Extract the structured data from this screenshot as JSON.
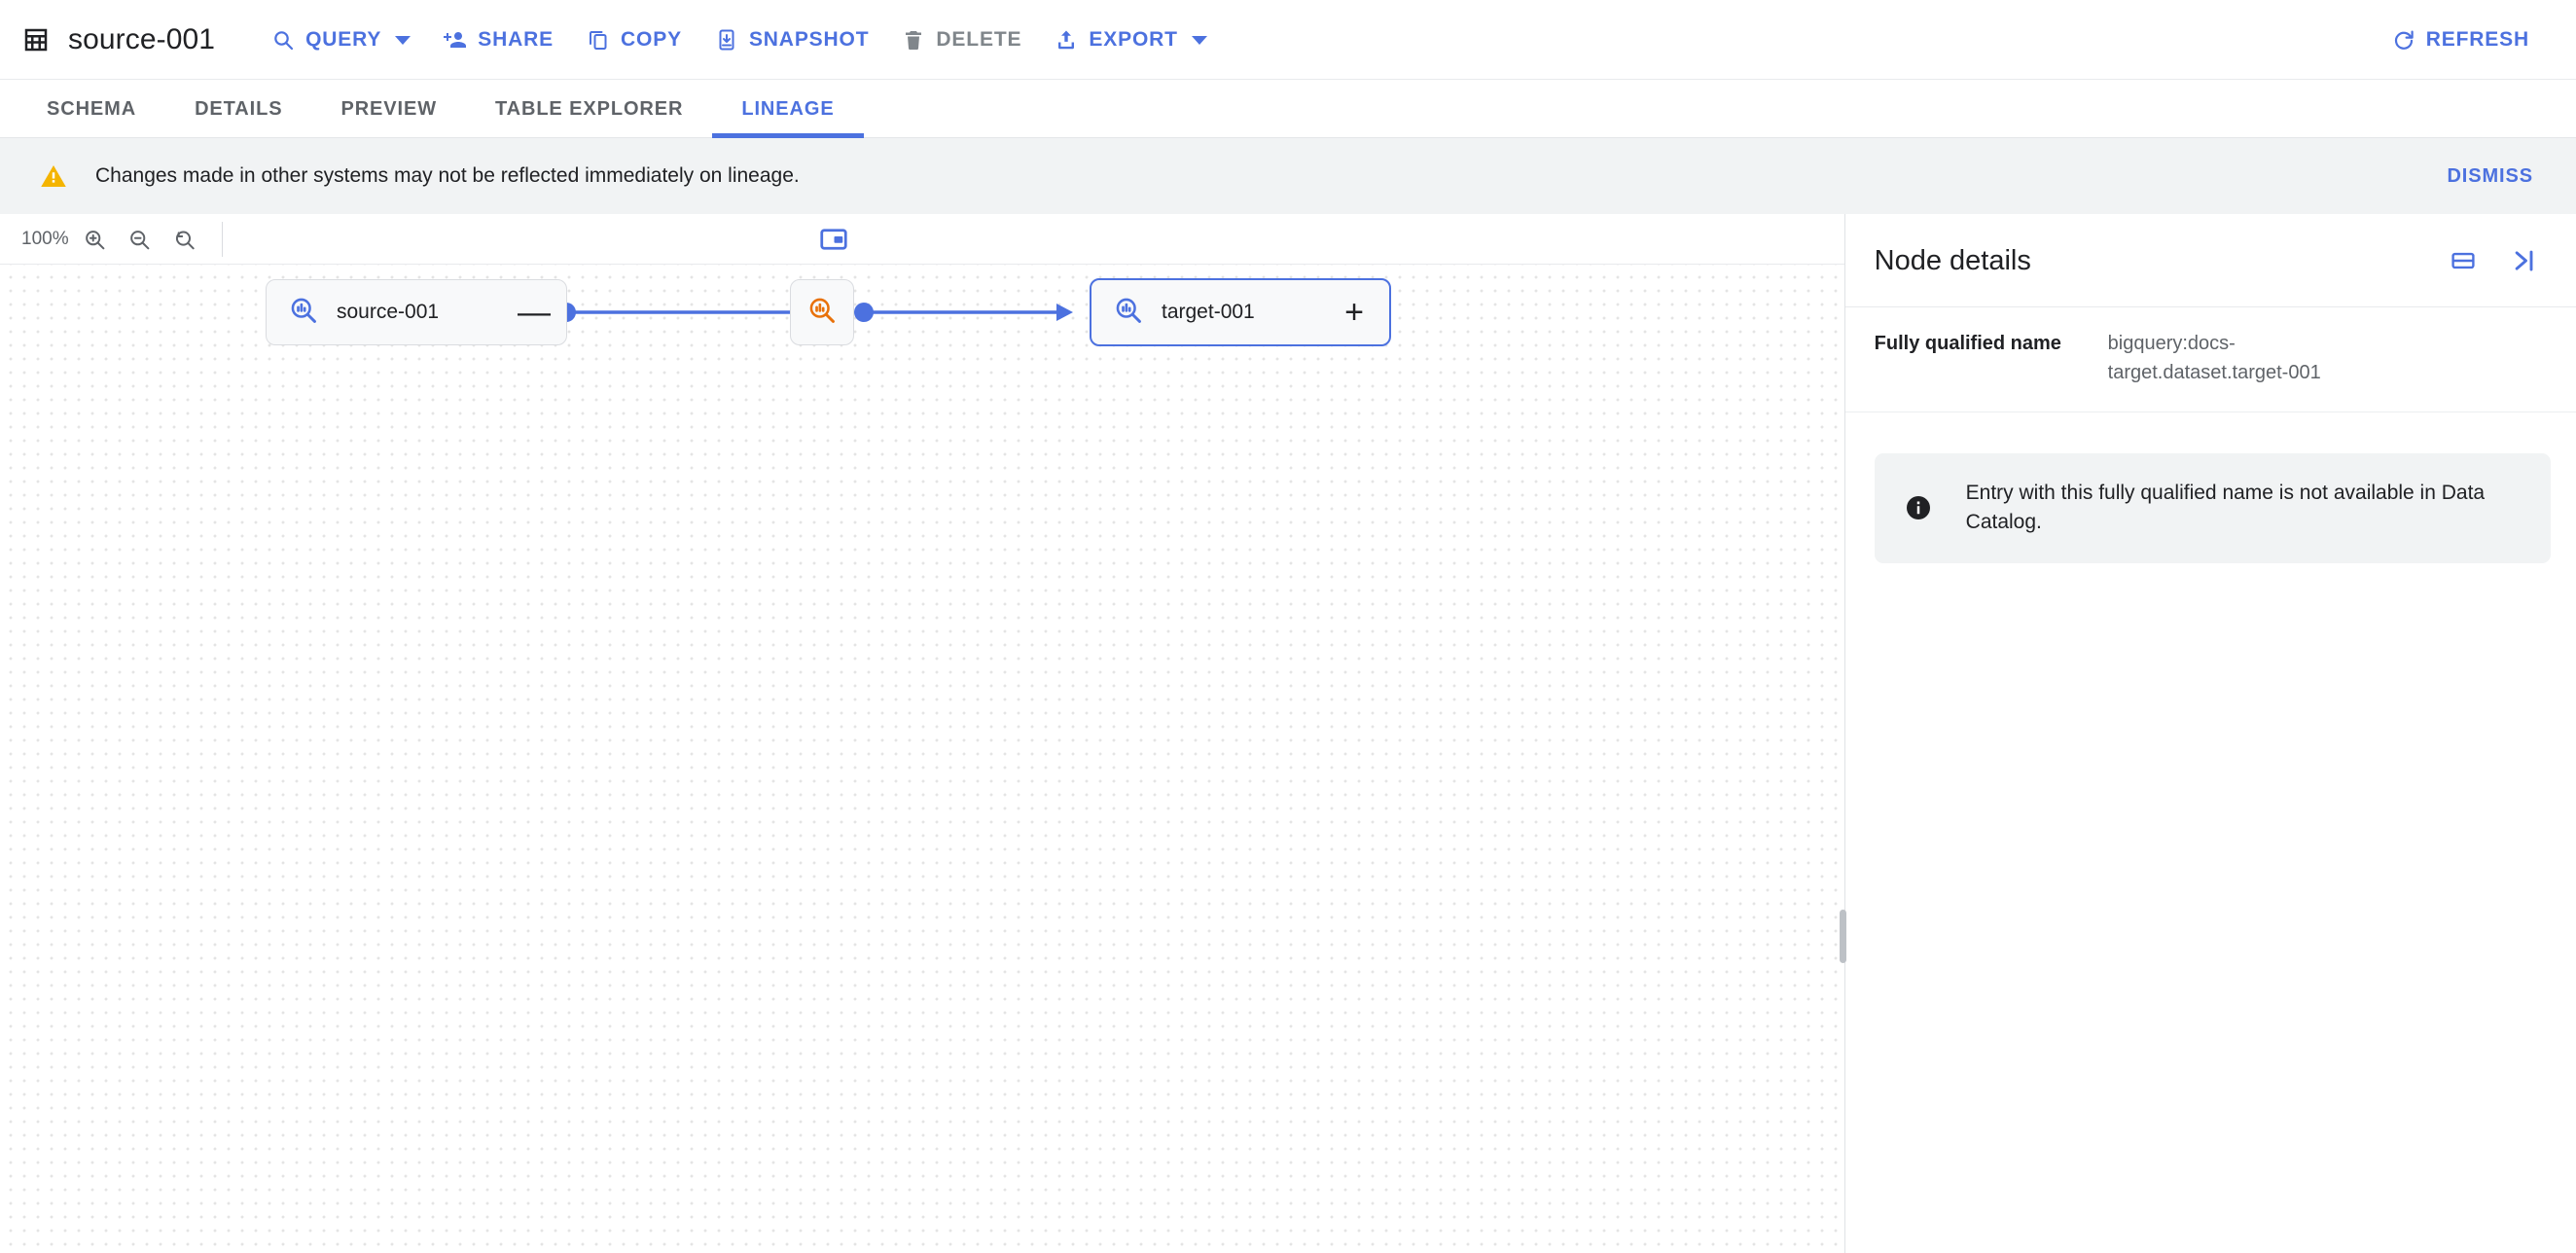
{
  "header": {
    "title": "source-001",
    "title_icon": "table-icon",
    "actions": [
      {
        "id": "query",
        "label": "QUERY",
        "icon": "search-icon",
        "has_caret": true,
        "disabled": false
      },
      {
        "id": "share",
        "label": "SHARE",
        "icon": "person-add-icon",
        "has_caret": false,
        "disabled": false
      },
      {
        "id": "copy",
        "label": "COPY",
        "icon": "copy-icon",
        "has_caret": false,
        "disabled": false
      },
      {
        "id": "snapshot",
        "label": "SNAPSHOT",
        "icon": "snapshot-icon",
        "has_caret": false,
        "disabled": false
      },
      {
        "id": "delete",
        "label": "DELETE",
        "icon": "trash-icon",
        "has_caret": false,
        "disabled": true
      },
      {
        "id": "export",
        "label": "EXPORT",
        "icon": "upload-icon",
        "has_caret": true,
        "disabled": false
      }
    ],
    "refresh": {
      "label": "REFRESH",
      "icon": "refresh-icon"
    }
  },
  "tabs": [
    {
      "label": "SCHEMA",
      "active": false
    },
    {
      "label": "DETAILS",
      "active": false
    },
    {
      "label": "PREVIEW",
      "active": false
    },
    {
      "label": "TABLE EXPLORER",
      "active": false
    },
    {
      "label": "LINEAGE",
      "active": true
    }
  ],
  "banner": {
    "icon": "warning-icon",
    "text": "Changes made in other systems may not be reflected immediately on lineage.",
    "dismiss_label": "DISMISS"
  },
  "canvas_toolbar": {
    "zoom_level": "100%",
    "zoom_in_icon": "zoom-in-icon",
    "zoom_out_icon": "zoom-out-icon",
    "zoom_reset_icon": "zoom-reset-icon",
    "minimap_icon": "minimap-icon"
  },
  "graph": {
    "nodes": [
      {
        "id": "source",
        "label": "source-001",
        "icon": "data-search-icon",
        "icon_color": "#4c71df",
        "toggle": "—",
        "toggle_name": "collapse",
        "selected": false
      },
      {
        "id": "process",
        "label": "",
        "icon": "data-search-icon",
        "icon_color": "#e8710a",
        "toggle": "",
        "toggle_name": "none",
        "selected": false
      },
      {
        "id": "target",
        "label": "target-001",
        "icon": "data-search-icon",
        "icon_color": "#4c71df",
        "toggle": "+",
        "toggle_name": "expand",
        "selected": true
      }
    ],
    "edges": [
      {
        "from": "source",
        "to": "process"
      },
      {
        "from": "process",
        "to": "target"
      }
    ],
    "edge_color": "#4c71df"
  },
  "panel": {
    "title": "Node details",
    "split_view_icon": "split-panel-icon",
    "collapse_icon": "collapse-right-icon",
    "details": [
      {
        "key": "Fully qualified name",
        "value": "bigquery:docs-target.dataset.target-001"
      }
    ],
    "info": {
      "icon": "info-icon",
      "text": "Entry with this fully qualified name is not available in Data Catalog."
    }
  },
  "colors": {
    "accent": "#4c71df",
    "orange": "#e8710a",
    "warning": "#f4b400",
    "text": "#202124",
    "muted": "#5f6368"
  }
}
